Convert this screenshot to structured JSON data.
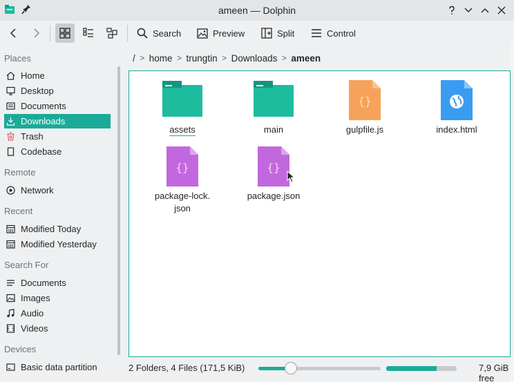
{
  "window": {
    "title": "ameen — Dolphin",
    "controls": [
      "help-icon",
      "minimize-icon",
      "maximize-icon",
      "close-icon"
    ]
  },
  "toolbar": {
    "back_icon": "chevron-left-icon",
    "forward_icon": "chevron-right-icon",
    "view_modes": [
      "icons-view-icon",
      "details-view-icon",
      "compact-view-icon"
    ],
    "search_label": "Search",
    "preview_label": "Preview",
    "split_label": "Split",
    "control_label": "Control"
  },
  "sidebar": {
    "places_title": "Places",
    "places": [
      {
        "label": "Home",
        "icon": "home-icon"
      },
      {
        "label": "Desktop",
        "icon": "desktop-icon"
      },
      {
        "label": "Documents",
        "icon": "documents-icon"
      },
      {
        "label": "Downloads",
        "icon": "downloads-icon",
        "selected": true
      },
      {
        "label": "Trash",
        "icon": "trash-icon"
      },
      {
        "label": "Codebase",
        "icon": "bookmark-icon"
      }
    ],
    "remote_title": "Remote",
    "remote": [
      {
        "label": "Network",
        "icon": "network-icon"
      }
    ],
    "recent_title": "Recent",
    "recent": [
      {
        "label": "Modified Today",
        "icon": "calendar-icon"
      },
      {
        "label": "Modified Yesterday",
        "icon": "calendar-icon"
      }
    ],
    "search_title": "Search For",
    "search_for": [
      {
        "label": "Documents",
        "icon": "documents-icon"
      },
      {
        "label": "Images",
        "icon": "image-icon"
      },
      {
        "label": "Audio",
        "icon": "audio-icon"
      },
      {
        "label": "Videos",
        "icon": "video-icon"
      }
    ],
    "devices_title": "Devices",
    "devices": [
      {
        "label": "Basic data partition",
        "icon": "drive-icon"
      }
    ]
  },
  "breadcrumb": {
    "root": "/",
    "parts": [
      "home",
      "trungtin",
      "Downloads"
    ],
    "current": "ameen"
  },
  "files": [
    {
      "name": "assets",
      "type": "folder"
    },
    {
      "name": "main",
      "type": "folder"
    },
    {
      "name": "gulpfile.js",
      "type": "js"
    },
    {
      "name": "index.html",
      "type": "html"
    },
    {
      "name": "package-lock.\njson",
      "type": "json"
    },
    {
      "name": "package.json",
      "type": "json"
    }
  ],
  "status": {
    "summary": "2 Folders, 4 Files (171,5 KiB)",
    "free_space": "7,9 GiB free",
    "disk_used_fraction": 0.72
  },
  "colors": {
    "accent": "#1aab98",
    "folder": "#1dbc9f",
    "js_file": "#f6a25a",
    "html_file": "#3a9cf0",
    "json_file": "#c268de"
  }
}
